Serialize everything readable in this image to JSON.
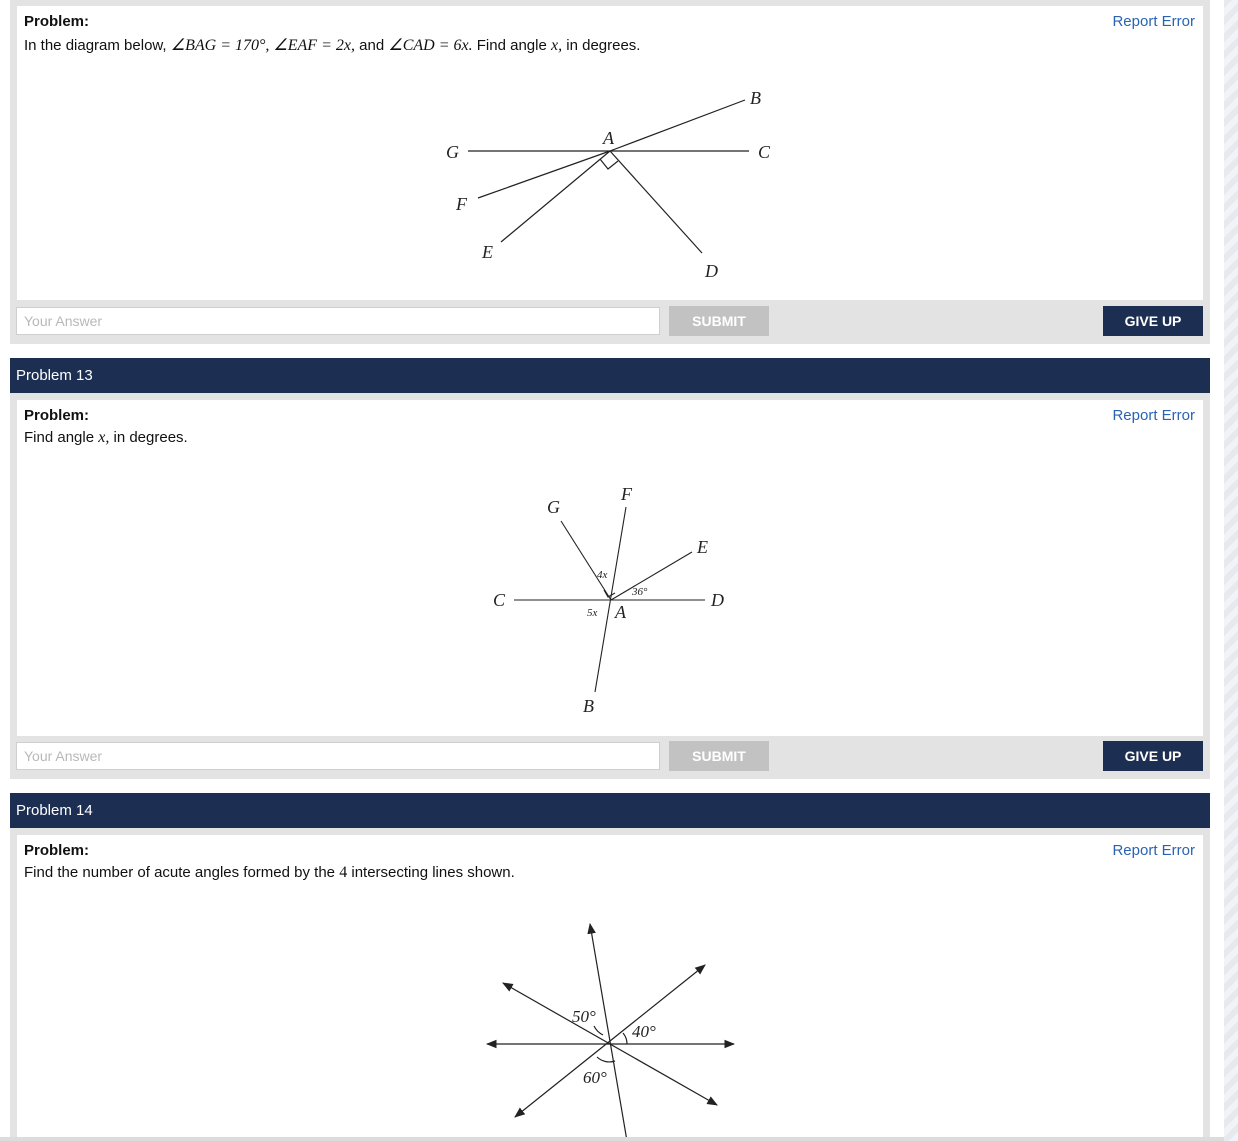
{
  "problems": [
    {
      "label": "Problem:",
      "report": "Report Error",
      "text_parts": [
        "In the diagram below, ",
        "∠BAG = 170°, ∠EAF = 2x,",
        " and ",
        "∠CAD = 6x.",
        " Find angle ",
        "x,",
        " in degrees."
      ],
      "answer_placeholder": "Your Answer",
      "submit": "SUBMIT",
      "give_up": "GIVE UP",
      "diagram_labels": {
        "A": "A",
        "B": "B",
        "C": "C",
        "D": "D",
        "E": "E",
        "F": "F",
        "G": "G"
      }
    },
    {
      "header": "Problem 13",
      "label": "Problem:",
      "report": "Report Error",
      "text_parts": [
        "Find angle ",
        "x,",
        " in degrees."
      ],
      "answer_placeholder": "Your Answer",
      "submit": "SUBMIT",
      "give_up": "GIVE UP",
      "diagram_labels": {
        "A": "A",
        "B": "B",
        "C": "C",
        "D": "D",
        "E": "E",
        "F": "F",
        "G": "G",
        "angle_4x": "4x",
        "angle_5x": "5x",
        "angle_36": "36°"
      }
    },
    {
      "header": "Problem 14",
      "label": "Problem:",
      "report": "Report Error",
      "text_parts": [
        "Find the number of acute angles formed by the ",
        "4",
        " intersecting lines shown."
      ],
      "diagram_labels": {
        "angle_50": "50°",
        "angle_40": "40°",
        "angle_60": "60°"
      }
    }
  ]
}
